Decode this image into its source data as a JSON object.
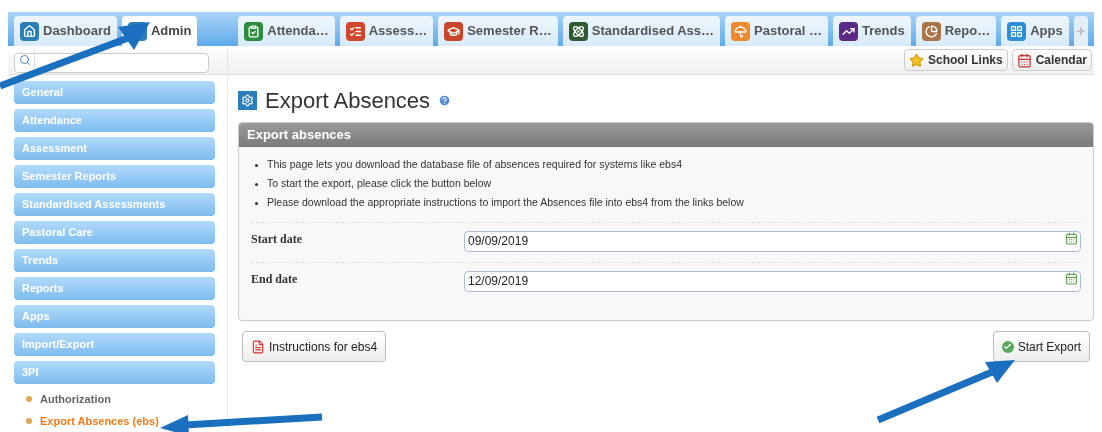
{
  "tabs": [
    {
      "label": "Dashboard",
      "color": "#2a7fb8",
      "selected": false
    },
    {
      "label": "Admin",
      "color": "#2a7fb8",
      "selected": true
    }
  ],
  "module_tabs": [
    {
      "label": "Attenda…",
      "color": "#2e8b3e",
      "selected": false
    },
    {
      "label": "Assess…",
      "color": "#d2472b",
      "selected": false
    },
    {
      "label": "Semester R…",
      "color": "#c9452b",
      "selected": false
    },
    {
      "label": "Standardised Ass…",
      "color": "#2f5a32",
      "selected": false
    },
    {
      "label": "Pastoral …",
      "color": "#ee8a2b",
      "selected": false
    },
    {
      "label": "Trends",
      "color": "#5b2a86",
      "selected": false
    },
    {
      "label": "Repo…",
      "color": "#a8744a",
      "selected": false
    },
    {
      "label": "Apps",
      "color": "#2f8fd6",
      "selected": false
    }
  ],
  "add_tab": {
    "label": "+",
    "disabled": true
  },
  "toolbar": {
    "links": [
      {
        "label": "School Links"
      },
      {
        "label": "Calendar"
      }
    ]
  },
  "sidebar": {
    "items": [
      {
        "label": "General"
      },
      {
        "label": "Attendance"
      },
      {
        "label": "Assessment"
      },
      {
        "label": "Semester Reports"
      },
      {
        "label": "Standardised Assessments"
      },
      {
        "label": "Pastoral Care"
      },
      {
        "label": "Trends"
      },
      {
        "label": "Reports"
      },
      {
        "label": "Apps"
      },
      {
        "label": "Import/Export"
      },
      {
        "label": "3PI"
      }
    ],
    "sub_items": [
      {
        "label": "Authorization",
        "selected": false
      },
      {
        "label": "Export Absences (ebs)",
        "selected": true
      }
    ]
  },
  "page": {
    "title": "Export Absences",
    "panel_title": "Export absences",
    "notes": [
      "This page lets you download the database file of absences required for systems like ebs4",
      "To start the export, please click the button below",
      "Please download the appropriate instructions to import the Absences file into ebs4 from the links below"
    ],
    "fields": [
      {
        "label": "Start date",
        "value": "09/09/2019"
      },
      {
        "label": "End date",
        "value": "12/09/2019"
      }
    ],
    "instructions_button": "Instructions for ebs4",
    "export_button": "Start Export"
  }
}
